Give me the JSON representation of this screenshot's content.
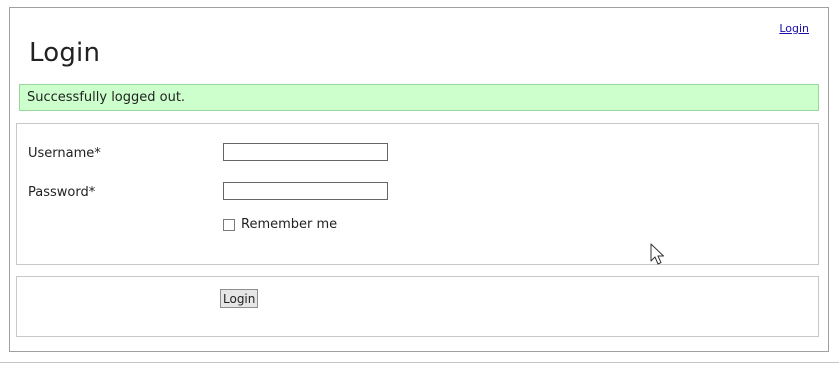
{
  "header": {
    "title": "Login",
    "login_link": "Login"
  },
  "notice": {
    "message": "Successfully logged out.",
    "background": "#ccffcc"
  },
  "form": {
    "username_label": "Username*",
    "username_value": "",
    "password_label": "Password*",
    "password_value": "",
    "remember_label": "Remember me",
    "remember_checked": false,
    "submit_label": "Login"
  },
  "icons": {
    "cursor": "mouse-pointer-icon"
  }
}
